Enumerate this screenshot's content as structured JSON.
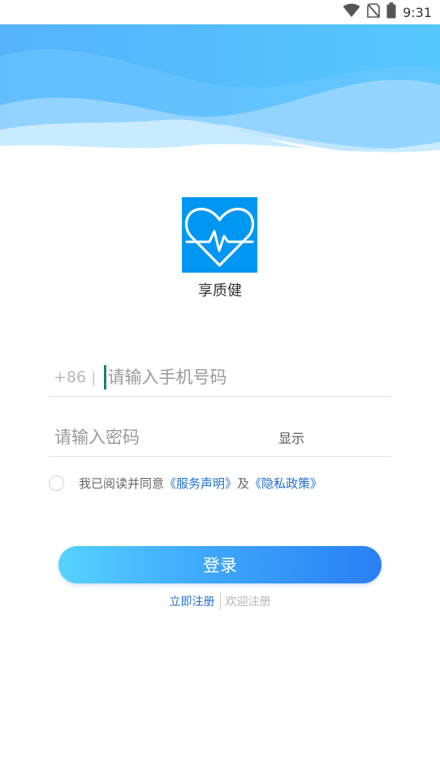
{
  "status_bar": {
    "time": "9:31",
    "icons": [
      "wifi-icon",
      "no-sim-icon",
      "battery-icon"
    ]
  },
  "app": {
    "name": "享质健",
    "logo_icon": "heart-pulse-icon",
    "logo_color": "#0097f3"
  },
  "form": {
    "country_code": "+86",
    "separator": "|",
    "phone_placeholder": "请输入手机号码",
    "password_placeholder": "请输入密码",
    "show_password_label": "显示"
  },
  "agreement": {
    "prefix": "我已阅读并同意",
    "service_link": "《服务声明》",
    "and": "及",
    "privacy_link": "《隐私政策》",
    "checked": false
  },
  "actions": {
    "login_label": "登录",
    "register_label": "立即注册",
    "welcome_label": "欢迎注册"
  },
  "colors": {
    "accent": "#1f6fd0",
    "button_gradient_start": "#56d2ff",
    "button_gradient_end": "#2a7ff4"
  }
}
